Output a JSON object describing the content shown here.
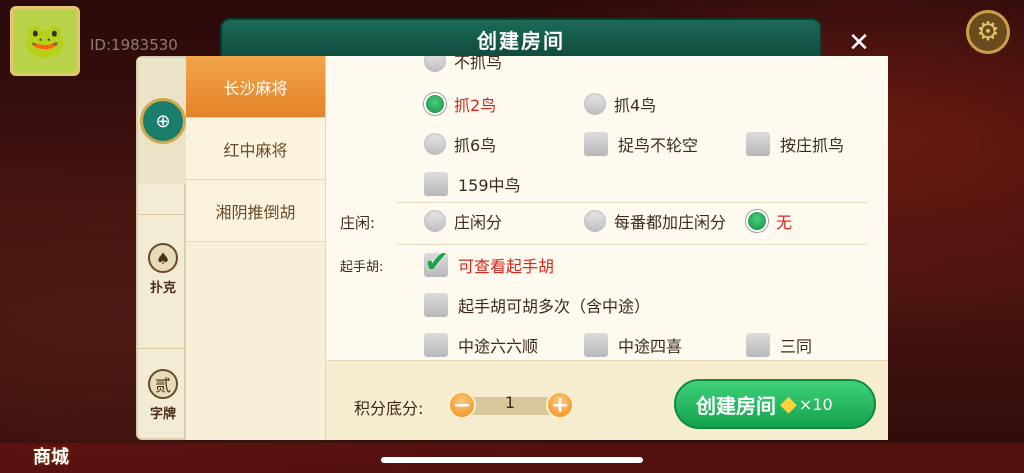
{
  "background": {
    "user_id": "ID:1983530",
    "shop_label": "商城"
  },
  "dialog": {
    "title": "创建房间",
    "close_icon": "close-icon",
    "sidebar": [
      {
        "label": "",
        "icon": "mahjong-emblem-icon",
        "active": true
      },
      {
        "label": "扑克",
        "icon": "spade-icon",
        "active": false
      },
      {
        "label": "字牌",
        "icon": "character-card-icon",
        "active": false
      }
    ],
    "subtabs": [
      {
        "label": "长沙麻将",
        "active": true
      },
      {
        "label": "红中麻将",
        "active": false
      },
      {
        "label": "湘阴推倒胡",
        "active": false
      }
    ],
    "options": {
      "bird_partial": "不抓鸟",
      "bird_2": "抓2鸟",
      "bird_4": "抓4鸟",
      "bird_6": "抓6鸟",
      "bird_no_empty": "捉鸟不轮空",
      "bird_by_dealer": "按庄抓鸟",
      "bird_159": "159中鸟",
      "dealer_label": "庄闲:",
      "dealer_opt1": "庄闲分",
      "dealer_opt2": "每番都加庄闲分",
      "dealer_opt3": "无",
      "start_hu_label": "起手胡:",
      "start_hu_view": "可查看起手胡",
      "start_hu_multi": "起手胡可胡多次（含中途）",
      "mid_66": "中途六六顺",
      "mid_4xi": "中途四喜",
      "san_tong": "三同"
    },
    "footer": {
      "score_label": "积分底分:",
      "score_value": "1",
      "create_label": "创建房间",
      "create_cost": "×10"
    }
  },
  "colors": {
    "title_green": "#1d6a58",
    "tab_orange": "#e5822a",
    "create_green": "#14a24c",
    "selected_red": "#d7261c"
  }
}
